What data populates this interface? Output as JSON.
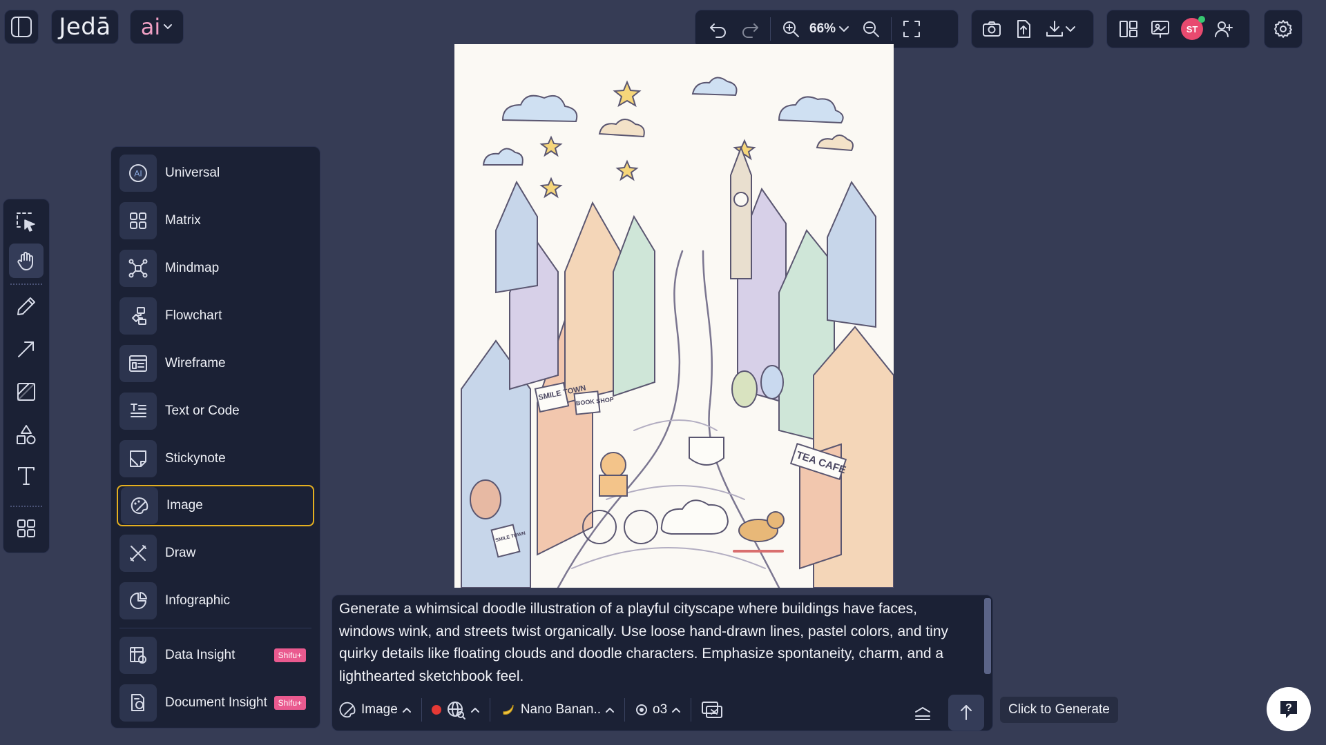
{
  "app": {
    "logo": "Jedā",
    "ai_label": "ai"
  },
  "toolbar": {
    "zoom": "66%"
  },
  "user": {
    "initials": "ST",
    "avatar_color": "#e84a6f"
  },
  "tool_rail": {
    "tools": [
      "select-tool",
      "hand-tool",
      "pen-tool",
      "arrow-tool",
      "frame-tool",
      "shapes-tool",
      "text-tool",
      "apps-tool"
    ],
    "active": "hand-tool"
  },
  "ai_menu": {
    "items": [
      {
        "label": "Universal"
      },
      {
        "label": "Matrix"
      },
      {
        "label": "Mindmap"
      },
      {
        "label": "Flowchart"
      },
      {
        "label": "Wireframe"
      },
      {
        "label": "Text or Code"
      },
      {
        "label": "Stickynote"
      },
      {
        "label": "Image"
      },
      {
        "label": "Draw"
      },
      {
        "label": "Infographic"
      },
      {
        "label": "Data Insight",
        "badge": "Shifu+"
      },
      {
        "label": "Document Insight",
        "badge": "Shifu+"
      }
    ],
    "selected": "Image"
  },
  "canvas": {
    "image_labels": [
      "SMILE TOWN",
      "BOOK SHOP",
      "TEA CAFE",
      "SMILE TOWN"
    ]
  },
  "composer": {
    "prompt": "Generate a whimsical doodle illustration of a playful cityscape where buildings have faces, windows wink, and streets twist organically. Use loose hand-drawn lines, pastel colors, and tiny quirky details like floating clouds and doodle characters. Emphasize spontaneity, charm, and a lighthearted sketchbook feel.",
    "mode": "Image",
    "model": "Nano Banan..",
    "reasoning": "o3",
    "status_color": "#e53935"
  },
  "tooltip": "Click to Generate",
  "colors": {
    "background": "#363c55",
    "panel": "#1b2135",
    "accent": "#e5b020",
    "badge": "#ea5a8f"
  }
}
